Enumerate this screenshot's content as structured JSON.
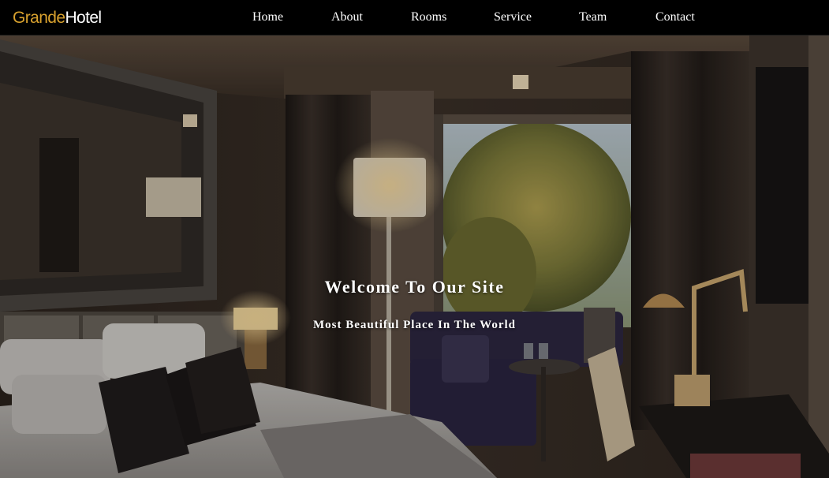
{
  "brand": {
    "part1": "Grande",
    "part2": "Hotel",
    "accent_color": "#d8a12e"
  },
  "nav": {
    "items": [
      {
        "label": "Home"
      },
      {
        "label": "About"
      },
      {
        "label": "Rooms"
      },
      {
        "label": "Service"
      },
      {
        "label": "Team"
      },
      {
        "label": "Contact"
      }
    ]
  },
  "hero": {
    "title": "Welcome To Our Site",
    "subtitle": "Most Beautiful Place In The World",
    "background": "hotel-room-photo"
  }
}
